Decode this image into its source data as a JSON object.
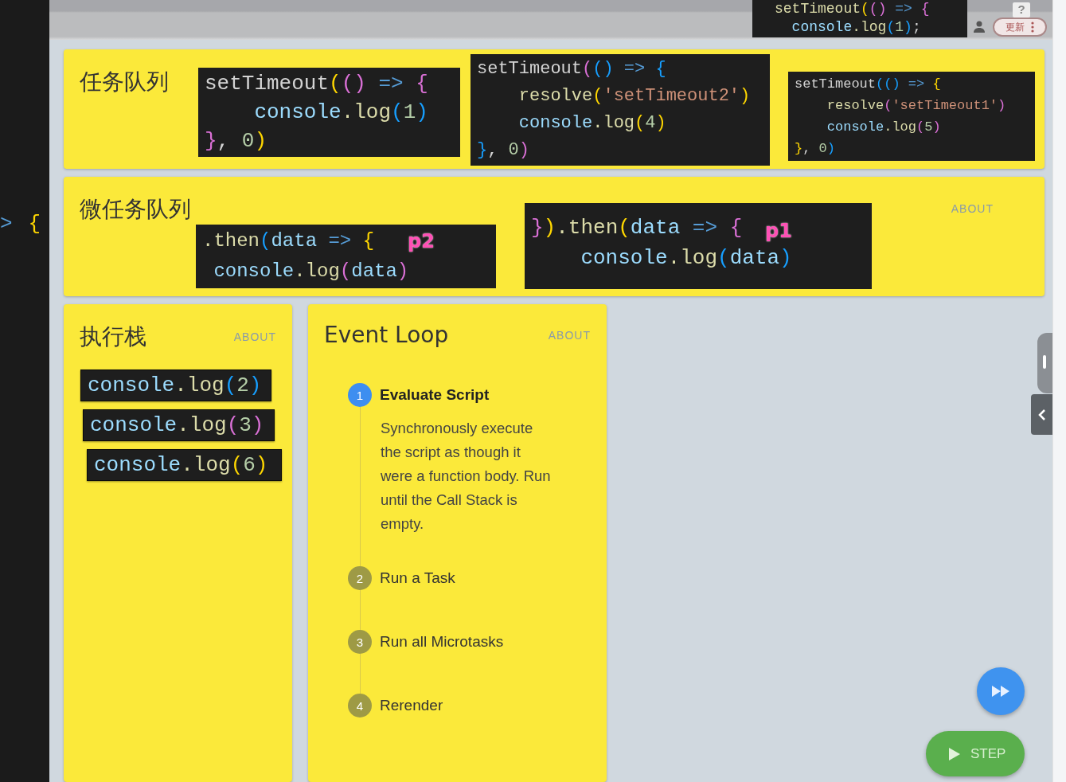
{
  "left_editor": {
    "lines": [
      [
        {
          "text": ">",
          "color": "#569cd6"
        },
        {
          "text": "{",
          "color": "#ffd700"
        }
      ]
    ]
  },
  "top_popup": {
    "lines": [
      [
        {
          "text": "setTimeout",
          "color": "#dcdcaa"
        },
        {
          "text": "(",
          "color": "#ffd700"
        },
        {
          "text": "()",
          "color": "#da70d6"
        },
        {
          "text": " => ",
          "color": "#569cd6"
        },
        {
          "text": "{",
          "color": "#da70d6"
        }
      ],
      [
        {
          "text": "  console",
          "color": "#9cdcfe"
        },
        {
          "text": ".log",
          "color": "#dcdcaa"
        },
        {
          "text": "(",
          "color": "#179fff"
        },
        {
          "text": "1",
          "color": "#b5cea8"
        },
        {
          "text": ")",
          "color": "#179fff"
        },
        {
          "text": ";",
          "color": "#d4d4d4"
        }
      ]
    ]
  },
  "help_badge": "?",
  "update_button": {
    "label": "更新"
  },
  "task_queue": {
    "title": "任务队列",
    "blocks": [
      {
        "lines": [
          [
            {
              "text": "setTimeout",
              "color": "#d4d4d4"
            },
            {
              "text": "(",
              "color": "#ffd700"
            },
            {
              "text": "()",
              "color": "#da70d6"
            },
            {
              "text": " => ",
              "color": "#569cd6"
            },
            {
              "text": "{",
              "color": "#da70d6"
            }
          ],
          [
            {
              "text": "    console",
              "color": "#9cdcfe"
            },
            {
              "text": ".log",
              "color": "#dcdcaa"
            },
            {
              "text": "(",
              "color": "#179fff"
            },
            {
              "text": "1",
              "color": "#b5cea8"
            },
            {
              "text": ")",
              "color": "#179fff"
            }
          ],
          [
            {
              "text": "}",
              "color": "#da70d6"
            },
            {
              "text": ", ",
              "color": "#d4d4d4"
            },
            {
              "text": "0",
              "color": "#b5cea8"
            },
            {
              "text": ")",
              "color": "#ffd700"
            }
          ]
        ]
      },
      {
        "lines": [
          [
            {
              "text": "setTimeout",
              "color": "#d4d4d4"
            },
            {
              "text": "(",
              "color": "#da70d6"
            },
            {
              "text": "()",
              "color": "#179fff"
            },
            {
              "text": " => ",
              "color": "#569cd6"
            },
            {
              "text": "{",
              "color": "#179fff"
            }
          ],
          [
            {
              "text": "    resolve",
              "color": "#dcdcaa"
            },
            {
              "text": "(",
              "color": "#ffd700"
            },
            {
              "text": "'setTimeout2'",
              "color": "#ce9178"
            },
            {
              "text": ")",
              "color": "#ffd700"
            }
          ],
          [
            {
              "text": "    console",
              "color": "#9cdcfe"
            },
            {
              "text": ".log",
              "color": "#dcdcaa"
            },
            {
              "text": "(",
              "color": "#ffd700"
            },
            {
              "text": "4",
              "color": "#b5cea8"
            },
            {
              "text": ")",
              "color": "#ffd700"
            }
          ],
          [
            {
              "text": "}",
              "color": "#179fff"
            },
            {
              "text": ", ",
              "color": "#d4d4d4"
            },
            {
              "text": "0",
              "color": "#b5cea8"
            },
            {
              "text": ")",
              "color": "#da70d6"
            }
          ]
        ]
      },
      {
        "lines": [
          [
            {
              "text": "setTimeout",
              "color": "#d4d4d4"
            },
            {
              "text": "(",
              "color": "#179fff"
            },
            {
              "text": "()",
              "color": "#179fff"
            },
            {
              "text": " => ",
              "color": "#569cd6"
            },
            {
              "text": "{",
              "color": "#ffd700"
            }
          ],
          [
            {
              "text": "    resolve",
              "color": "#dcdcaa"
            },
            {
              "text": "(",
              "color": "#da70d6"
            },
            {
              "text": "'setTimeout1'",
              "color": "#ce9178"
            },
            {
              "text": ")",
              "color": "#da70d6"
            }
          ],
          [
            {
              "text": "    console",
              "color": "#9cdcfe"
            },
            {
              "text": ".log",
              "color": "#dcdcaa"
            },
            {
              "text": "(",
              "color": "#da70d6"
            },
            {
              "text": "5",
              "color": "#b5cea8"
            },
            {
              "text": ")",
              "color": "#da70d6"
            }
          ],
          [
            {
              "text": "}",
              "color": "#ffd700"
            },
            {
              "text": ", ",
              "color": "#d4d4d4"
            },
            {
              "text": "0",
              "color": "#b5cea8"
            },
            {
              "text": ")",
              "color": "#179fff"
            }
          ]
        ]
      }
    ]
  },
  "microtask_queue": {
    "title": "微任务队列",
    "about": "ABOUT",
    "blocks": [
      {
        "annotation": "p2",
        "lines": [
          [
            {
              "text": ".then",
              "color": "#dcdcaa"
            },
            {
              "text": "(",
              "color": "#179fff"
            },
            {
              "text": "data",
              "color": "#9cdcfe"
            },
            {
              "text": " => ",
              "color": "#569cd6"
            },
            {
              "text": "{",
              "color": "#ffd700"
            }
          ],
          [
            {
              "text": " console",
              "color": "#9cdcfe"
            },
            {
              "text": ".log",
              "color": "#dcdcaa"
            },
            {
              "text": "(",
              "color": "#da70d6"
            },
            {
              "text": "data",
              "color": "#9cdcfe"
            },
            {
              "text": ")",
              "color": "#da70d6"
            }
          ]
        ]
      },
      {
        "annotation": "p1",
        "lines": [
          [
            {
              "text": "}",
              "color": "#da70d6"
            },
            {
              "text": ")",
              "color": "#ffd700"
            },
            {
              "text": ".then",
              "color": "#dcdcaa"
            },
            {
              "text": "(",
              "color": "#ffd700"
            },
            {
              "text": "data",
              "color": "#9cdcfe"
            },
            {
              "text": " => ",
              "color": "#569cd6"
            },
            {
              "text": "{",
              "color": "#da70d6"
            }
          ],
          [
            {
              "text": "    console",
              "color": "#9cdcfe"
            },
            {
              "text": ".log",
              "color": "#dcdcaa"
            },
            {
              "text": "(",
              "color": "#179fff"
            },
            {
              "text": "data",
              "color": "#9cdcfe"
            },
            {
              "text": ")",
              "color": "#179fff"
            }
          ]
        ]
      }
    ]
  },
  "call_stack": {
    "title": "执行栈",
    "about": "ABOUT",
    "frames": [
      [
        {
          "text": "console",
          "color": "#9cdcfe"
        },
        {
          "text": ".log",
          "color": "#dcdcaa"
        },
        {
          "text": "(",
          "color": "#179fff"
        },
        {
          "text": "2",
          "color": "#b5cea8"
        },
        {
          "text": ")",
          "color": "#179fff"
        }
      ],
      [
        {
          "text": "console",
          "color": "#9cdcfe"
        },
        {
          "text": ".log",
          "color": "#dcdcaa"
        },
        {
          "text": "(",
          "color": "#da70d6"
        },
        {
          "text": "3",
          "color": "#b5cea8"
        },
        {
          "text": ")",
          "color": "#da70d6"
        }
      ],
      [
        {
          "text": "console",
          "color": "#9cdcfe"
        },
        {
          "text": ".log",
          "color": "#dcdcaa"
        },
        {
          "text": "(",
          "color": "#ffd700"
        },
        {
          "text": "6",
          "color": "#b5cea8"
        },
        {
          "text": ")",
          "color": "#ffd700"
        }
      ]
    ]
  },
  "event_loop": {
    "title": "Event Loop",
    "about": "ABOUT",
    "steps": [
      {
        "number": "1",
        "label": "Evaluate Script",
        "selected": true,
        "description": "Synchronously execute the script as though it were a function body. Run until the Call Stack is empty."
      },
      {
        "number": "2",
        "label": "Run a Task",
        "selected": false
      },
      {
        "number": "3",
        "label": "Run all Microtasks",
        "selected": false
      },
      {
        "number": "4",
        "label": "Rerender",
        "selected": false
      }
    ]
  },
  "controls": {
    "step_button": "STEP"
  }
}
